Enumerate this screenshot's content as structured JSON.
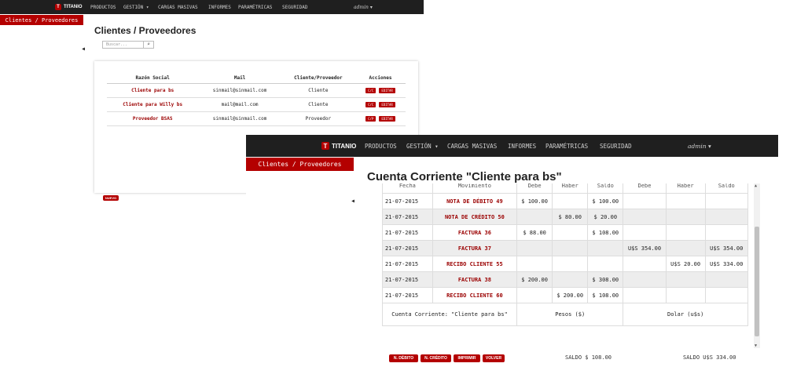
{
  "window1": {
    "brand": "TITANIO",
    "nav": [
      "PRODUCTOS",
      "GESTIÓN",
      "CARGAS MASIVAS",
      "INFORMES",
      "PARAMÉTRICAS",
      "SEGURIDAD"
    ],
    "user": "admin",
    "sidebar_active": "Clientes / Proveedores",
    "title": "Clientes / Proveedores",
    "search_placeholder": "Buscar...",
    "table": {
      "headers": [
        "Razón Social",
        "Mail",
        "Cliente/Proveedor",
        "Acciones"
      ],
      "rows": [
        {
          "name": "Cliente para bs",
          "mail": "sinmail@sinmail.com",
          "type": "Cliente",
          "a1": "C/C",
          "a2": "EDITAR"
        },
        {
          "name": "Cliente para Willy bs",
          "mail": "mail@mail.com",
          "type": "Cliente",
          "a1": "C/C",
          "a2": "EDITAR"
        },
        {
          "name": "Proveedor BSAS",
          "mail": "sinmail@sinmail.com",
          "type": "Proveedor",
          "a1": "C/P",
          "a2": "EDITAR"
        }
      ]
    },
    "new_button": "NUEVO"
  },
  "window2": {
    "brand": "TITANIO",
    "nav": [
      "PRODUCTOS",
      "GESTIÓN",
      "CARGAS MASIVAS",
      "INFORMES",
      "PARAMÉTRICAS",
      "SEGURIDAD"
    ],
    "user": "admin",
    "sidebar_active": "Clientes / Proveedores",
    "title": "Cuenta Corriente \"Cliente para bs\"",
    "headers": [
      "Fecha",
      "Movimiento",
      "Debe",
      "Haber",
      "Saldo",
      "Debe",
      "Haber",
      "Saldo"
    ],
    "rows": [
      {
        "fecha": "21-07-2015",
        "mov": "NOTA DE DÉBITO 49",
        "d1": "$ 100.00",
        "h1": "",
        "s1": "$ 100.00",
        "d2": "",
        "h2": "",
        "s2": ""
      },
      {
        "fecha": "21-07-2015",
        "mov": "NOTA DE CRÉDITO 50",
        "d1": "",
        "h1": "$ 80.00",
        "s1": "$ 20.00",
        "d2": "",
        "h2": "",
        "s2": ""
      },
      {
        "fecha": "21-07-2015",
        "mov": "FACTURA 36",
        "d1": "$ 88.00",
        "h1": "",
        "s1": "$ 108.00",
        "d2": "",
        "h2": "",
        "s2": ""
      },
      {
        "fecha": "21-07-2015",
        "mov": "FACTURA 37",
        "d1": "",
        "h1": "",
        "s1": "",
        "d2": "U$S 354.00",
        "h2": "",
        "s2": "U$S 354.00"
      },
      {
        "fecha": "21-07-2015",
        "mov": "RECIBO CLIENTE 55",
        "d1": "",
        "h1": "",
        "s1": "",
        "d2": "",
        "h2": "U$S 20.00",
        "s2": "U$S 334.00"
      },
      {
        "fecha": "21-07-2015",
        "mov": "FACTURA 38",
        "d1": "$ 200.00",
        "h1": "",
        "s1": "$ 308.00",
        "d2": "",
        "h2": "",
        "s2": ""
      },
      {
        "fecha": "21-07-2015",
        "mov": "RECIBO CLIENTE 60",
        "d1": "",
        "h1": "$ 200.00",
        "s1": "$ 108.00",
        "d2": "",
        "h2": "",
        "s2": ""
      }
    ],
    "footer": {
      "label": "Cuenta Corriente: \"Cliente para bs\"",
      "pesos": "Pesos ($)",
      "dolar": "Dolar (u$s)"
    },
    "buttons": [
      "N. DÉBITO",
      "N. CRÉDITO",
      "IMPRIMIR",
      "VOLVER"
    ],
    "saldo_pesos": "SALDO $ 108.00",
    "saldo_dolar": "SALDO U$S 334.00"
  }
}
